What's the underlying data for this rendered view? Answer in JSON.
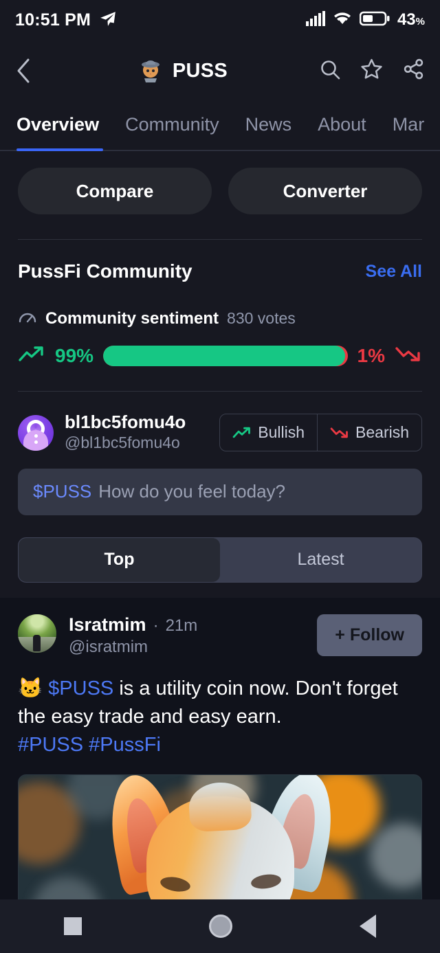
{
  "status_bar": {
    "time": "10:51 PM",
    "telegram_icon": "telegram-send-icon",
    "signal_icon": "cellular-signal-icon",
    "wifi_icon": "wifi-icon",
    "battery_icon": "battery-icon",
    "battery_percent": "43",
    "battery_unit": "%"
  },
  "app_bar": {
    "back_icon": "chevron-left-icon",
    "coin_logo": "puss-cowboy-cat-logo",
    "title": "PUSS",
    "search_icon": "search-icon",
    "star_icon": "star-icon",
    "share_icon": "share-icon"
  },
  "tabs": {
    "items": [
      {
        "label": "Overview",
        "active": true
      },
      {
        "label": "Community",
        "active": false
      },
      {
        "label": "News",
        "active": false
      },
      {
        "label": "About",
        "active": false
      },
      {
        "label": "Mar",
        "active": false
      }
    ],
    "active_color": "#3a65f5"
  },
  "actions": {
    "compare_label": "Compare",
    "converter_label": "Converter"
  },
  "community": {
    "section_title": "PussFi Community",
    "see_all_label": "See All",
    "sentiment": {
      "gauge_icon": "gauge-icon",
      "label": "Community sentiment",
      "votes": "830 votes",
      "bullish_percent": "99%",
      "bearish_percent": "1%",
      "bullish_value": 99,
      "bearish_value": 1,
      "bullish_color": "#16c784",
      "bearish_color": "#ea3943",
      "up_icon": "trend-up-icon",
      "down_icon": "trend-down-icon"
    }
  },
  "compose": {
    "avatar": "user-avatar-cmc",
    "display_name": "bl1bc5fomu4o",
    "handle": "@bl1bc5fomu4o",
    "bullish_label": "Bullish",
    "bearish_label": "Bearish",
    "bullish_icon": "trend-up-icon",
    "bearish_icon": "trend-down-icon",
    "input_token": "$PUSS",
    "input_placeholder": "How do you feel today?"
  },
  "feed_filter": {
    "top_label": "Top",
    "latest_label": "Latest",
    "selected": "Top"
  },
  "post": {
    "avatar": "author-photo-avatar",
    "author": "Isratmim",
    "separator": "·",
    "time": "21m",
    "handle": "@isratmim",
    "follow_label": "+ Follow",
    "emoji": "🐱",
    "token": "$PUSS",
    "text": " is a utility coin now. Don't forget the easy trade and easy earn.",
    "hashtags": "#PUSS #PussFi",
    "image": "fluffy-kitten-bokeh-photo"
  },
  "android_nav": {
    "recents_icon": "square-recents-icon",
    "home_icon": "circle-home-icon",
    "back_icon": "triangle-back-icon"
  }
}
